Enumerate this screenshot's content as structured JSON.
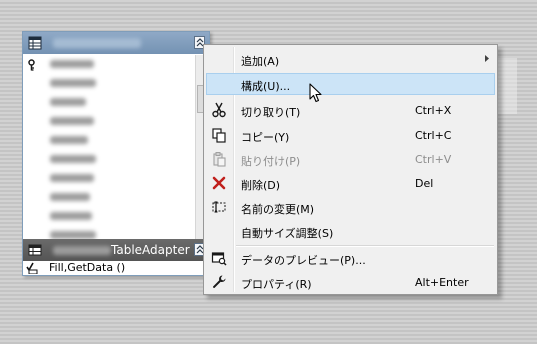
{
  "table": {
    "title_blurred": true,
    "columns_blurred_count": 11,
    "adapter_title": "TableAdapter",
    "fill_method": "Fill,GetData ()"
  },
  "menu": {
    "items": [
      {
        "label": "追加(A)",
        "shortcut": "",
        "icon": "",
        "submenu": true,
        "disabled": false,
        "highlighted": false
      },
      {
        "label": "構成(U)...",
        "shortcut": "",
        "icon": "",
        "submenu": false,
        "disabled": false,
        "highlighted": true
      },
      {
        "label": "切り取り(T)",
        "shortcut": "Ctrl+X",
        "icon": "scissors-icon",
        "submenu": false,
        "disabled": false,
        "highlighted": false
      },
      {
        "label": "コピー(Y)",
        "shortcut": "Ctrl+C",
        "icon": "copy-icon",
        "submenu": false,
        "disabled": false,
        "highlighted": false
      },
      {
        "label": "貼り付け(P)",
        "shortcut": "Ctrl+V",
        "icon": "paste-icon",
        "submenu": false,
        "disabled": true,
        "highlighted": false
      },
      {
        "label": "削除(D)",
        "shortcut": "Del",
        "icon": "delete-x-icon",
        "submenu": false,
        "disabled": false,
        "highlighted": false
      },
      {
        "label": "名前の変更(M)",
        "shortcut": "",
        "icon": "rename-icon",
        "submenu": false,
        "disabled": false,
        "highlighted": false
      },
      {
        "label": "自動サイズ調整(S)",
        "shortcut": "",
        "icon": "",
        "submenu": false,
        "disabled": false,
        "highlighted": false
      },
      {
        "label": "データのプレビュー(P)...",
        "shortcut": "",
        "icon": "data-preview-icon",
        "submenu": false,
        "disabled": false,
        "highlighted": false
      },
      {
        "label": "プロパティ(R)",
        "shortcut": "Alt+Enter",
        "icon": "wrench-icon",
        "submenu": false,
        "disabled": false,
        "highlighted": false
      }
    ]
  },
  "colors": {
    "highlight_bg": "#cce4f7",
    "highlight_border": "#a9cfee",
    "delete_icon": "#c0201c",
    "table_header": "#7f9dba"
  }
}
